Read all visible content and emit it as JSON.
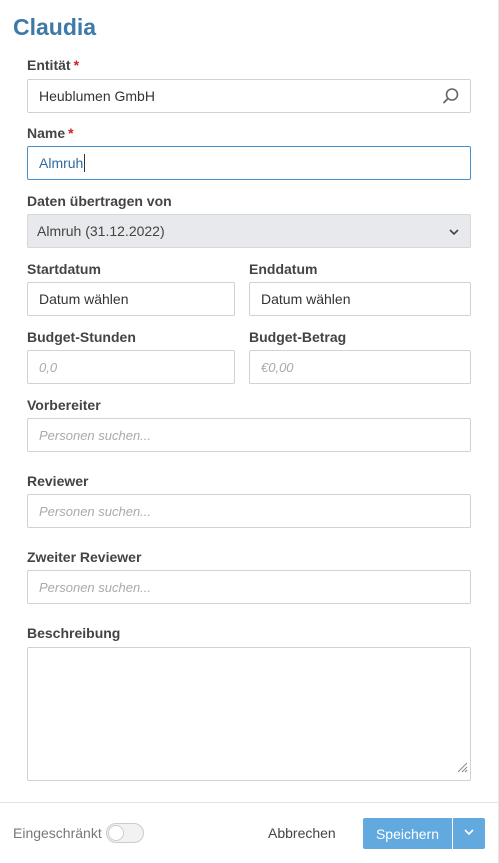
{
  "title": "Claudia",
  "entity": {
    "label": "Entität",
    "required_mark": "*",
    "value": "Heublumen GmbH",
    "icon": "search-icon"
  },
  "name": {
    "label": "Name",
    "required_mark": "*",
    "value": "Almruh"
  },
  "transfer": {
    "label": "Daten übertragen von",
    "selected": "Almruh (31.12.2022)",
    "icon": "chevron-down-icon"
  },
  "start_date": {
    "label": "Startdatum",
    "value": "Datum wählen"
  },
  "end_date": {
    "label": "Enddatum",
    "value": "Datum wählen"
  },
  "budget_hours": {
    "label": "Budget-Stunden",
    "placeholder": "0,0"
  },
  "budget_amount": {
    "label": "Budget-Betrag",
    "placeholder": "€0,00"
  },
  "preparer": {
    "label": "Vorbereiter",
    "placeholder": "Personen suchen..."
  },
  "reviewer": {
    "label": "Reviewer",
    "placeholder": "Personen suchen..."
  },
  "second_reviewer": {
    "label": "Zweiter Reviewer",
    "placeholder": "Personen suchen..."
  },
  "description": {
    "label": "Beschreibung",
    "value": ""
  },
  "footer": {
    "restricted_label": "Eingeschränkt",
    "restricted_on": false,
    "cancel_label": "Abbrechen",
    "save_label": "Speichern"
  },
  "colors": {
    "title": "#3d79a9",
    "primary_button": "#62a9e0",
    "focus_border": "#4a90c8",
    "required": "#d21f1f"
  }
}
